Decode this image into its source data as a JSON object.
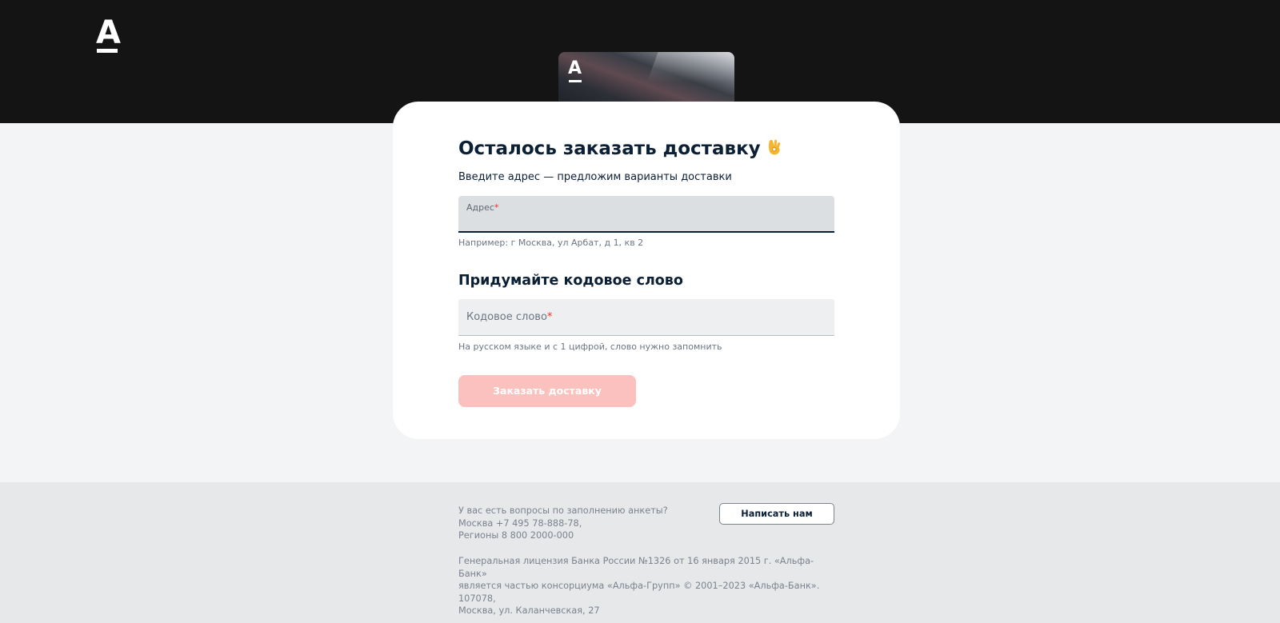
{
  "header": {
    "logo_letter": "А",
    "card_logo_letter": "А"
  },
  "form": {
    "title": "Осталось заказать доставку",
    "title_emoji": "ok-hand-emoji",
    "subtitle": "Введите адрес — предложим варианты доставки",
    "address": {
      "label": "Адрес",
      "required_mark": "*",
      "value": "",
      "hint": "Например: г Москва, ул Арбат, д 1, кв 2"
    },
    "codeword_heading": "Придумайте кодовое слово",
    "codeword": {
      "placeholder": "Кодовое слово",
      "required_mark": "*",
      "value": "",
      "hint": "На русском языке и с 1 цифрой, слово нужно запомнить"
    },
    "submit_label": "Заказать доставку"
  },
  "footer": {
    "question": "У вас есть вопросы по заполнению анкеты?",
    "phone_moscow": "Москва +7 495 78-888-78,",
    "phone_regions": "Регионы 8 800 2000-000",
    "write_us_label": "Написать нам",
    "license_line1": "Генеральная лицензия Банка России №1326 от 16 января 2015 г. «Альфа-Банк»",
    "license_line2": "является частью консорциума «Альфа-Групп» © 2001–2023 «Альфа-Банк». 107078,",
    "license_line3": "Москва, ул. Каланчевская, 27"
  },
  "colors": {
    "brand_red": "#ef3124",
    "header_bg": "#141414",
    "button_disabled": "#fbc1be"
  }
}
